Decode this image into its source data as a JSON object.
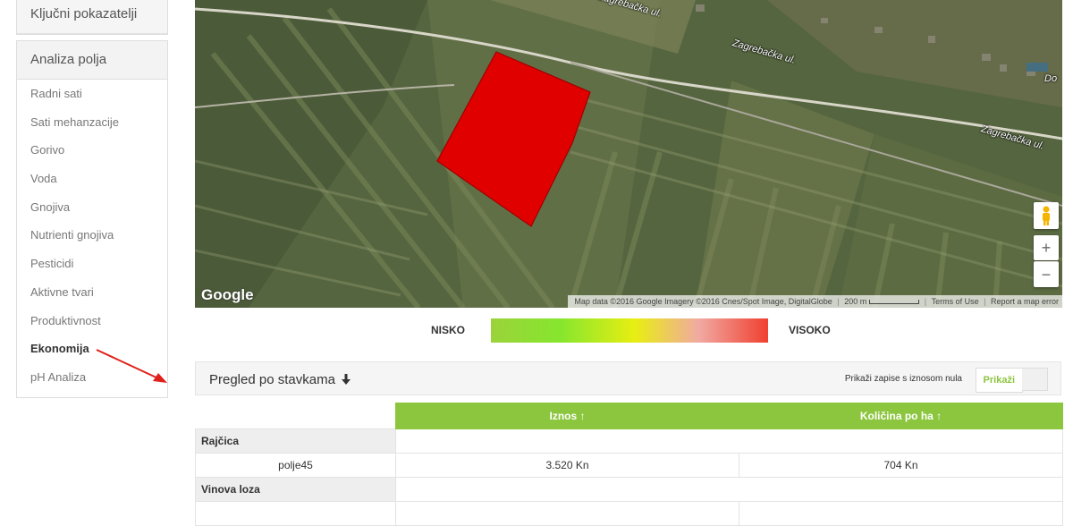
{
  "sidebar": {
    "top_item": "Ključni pokazatelji",
    "section": "Analiza polja",
    "items": [
      {
        "label": "Radni sati"
      },
      {
        "label": "Sati mehanzacije"
      },
      {
        "label": "Gorivo"
      },
      {
        "label": "Voda"
      },
      {
        "label": "Gnojiva"
      },
      {
        "label": "Nutrienti gnojiva"
      },
      {
        "label": "Pesticidi"
      },
      {
        "label": "Aktivne tvari"
      },
      {
        "label": "Produktivnost"
      },
      {
        "label": "Ekonomija"
      },
      {
        "label": "pH Analiza"
      }
    ],
    "active_item": "Ekonomija"
  },
  "map": {
    "streets": [
      "Zagrebačka ul.",
      "Zagrebačka ul.",
      "Zagrebačka ul.",
      "Do"
    ],
    "logo": "Google",
    "attribution": "Map data ©2016 Google Imagery ©2016 Cnes/Spot Image, DigitalGlobe",
    "scale": "200 m",
    "terms": "Terms of Use",
    "report": "Report a map error",
    "controls": {
      "pegman": "pegman-icon",
      "zoom_in": "+",
      "zoom_out": "−"
    },
    "field_color": "#e00000"
  },
  "legend": {
    "low": "NISKO",
    "high": "VISOKO",
    "colors": [
      "#9bd33a",
      "#86e62e",
      "#e8ee12",
      "#f1a9a2",
      "#f04030"
    ]
  },
  "panel": {
    "title": "Pregled po stavkama",
    "title_icon": "arrow-down-icon",
    "zero_records_label": "Prikaži zapise s iznosom nula",
    "show_button": "Prikaži"
  },
  "table": {
    "columns": [
      "Iznos ↑",
      "Količina po ha ↑"
    ],
    "groups": [
      {
        "name": "Rajčica",
        "rows": [
          {
            "field": "polje45",
            "amount": "3.520 Kn",
            "per_ha": "704 Kn"
          }
        ]
      },
      {
        "name": "Vinova loza",
        "rows": []
      }
    ]
  },
  "colors": {
    "accent_green": "#8cc63f",
    "arrow_red": "#e0201b"
  }
}
